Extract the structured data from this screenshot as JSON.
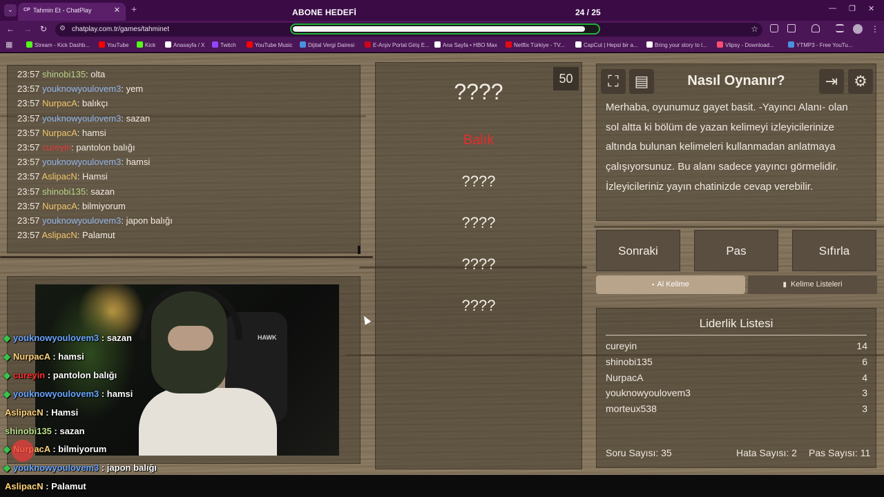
{
  "browser": {
    "tab_title": "Tahmin Et - ChatPlay",
    "tab_favicon": "CP",
    "url": "chatplay.com.tr/games/tahminet",
    "bookmarks": [
      {
        "label": "Stream - Kick Dashb...",
        "color": "#53fc18"
      },
      {
        "label": "YouTube",
        "color": "#ff0000"
      },
      {
        "label": "Kick",
        "color": "#53fc18"
      },
      {
        "label": "Anasayfa / X",
        "color": "#ffffff"
      },
      {
        "label": "Twitch",
        "color": "#9146ff"
      },
      {
        "label": "YouTube Music",
        "color": "#ff0000"
      },
      {
        "label": "Dijital Vergi Dairesi",
        "color": "#4a90e2"
      },
      {
        "label": "E-Arşiv Portal Giriş E...",
        "color": "#d0021b"
      },
      {
        "label": "Ana Sayfa • HBO Max",
        "color": "#ffffff"
      },
      {
        "label": "Netflix Türkiye - TV...",
        "color": "#e50914"
      },
      {
        "label": "CapCut | Hepsi bir a...",
        "color": "#ffffff"
      },
      {
        "label": "Bring your story to l...",
        "color": "#ffffff"
      },
      {
        "label": "Vlipsy - Download...",
        "color": "#ff4d6d"
      },
      {
        "label": "YTMP3 - Free YouTu...",
        "color": "#4a90e2"
      }
    ]
  },
  "goal": {
    "label": "ABONE HEDEFİ",
    "count": "24 / 25",
    "progress": 0.96
  },
  "chat_log": [
    {
      "time": "23:57",
      "user": "shinobi135",
      "color": "#b9d38a",
      "msg": "olta"
    },
    {
      "time": "23:57",
      "user": "youknowyoulovem3",
      "color": "#8fb5ec",
      "msg": "yem"
    },
    {
      "time": "23:57",
      "user": "NurpacA",
      "color": "#f0c66c",
      "msg": "balıkçı"
    },
    {
      "time": "23:57",
      "user": "youknowyoulovem3",
      "color": "#8fb5ec",
      "msg": "sazan"
    },
    {
      "time": "23:57",
      "user": "NurpacA",
      "color": "#f0c66c",
      "msg": "hamsi"
    },
    {
      "time": "23:57",
      "user": "cureyin",
      "color": "#e33b3b",
      "msg": "pantolon balığı"
    },
    {
      "time": "23:57",
      "user": "youknowyoulovem3",
      "color": "#8fb5ec",
      "msg": "hamsi"
    },
    {
      "time": "23:57",
      "user": "AslipacN",
      "color": "#f0c66c",
      "msg": "Hamsi"
    },
    {
      "time": "23:57",
      "user": "shinobi135",
      "color": "#b9d38a",
      "msg": "sazan"
    },
    {
      "time": "23:57",
      "user": "NurpacA",
      "color": "#f0c66c",
      "msg": "bilmiyorum"
    },
    {
      "time": "23:57",
      "user": "youknowyoulovem3",
      "color": "#8fb5ec",
      "msg": "japon balığı"
    },
    {
      "time": "23:57",
      "user": "AslipacN",
      "color": "#f0c66c",
      "msg": "Palamut"
    }
  ],
  "stream_overlay": [
    {
      "user": "youknowyoulovem3",
      "color": "#6aa6ff",
      "msg": "sazan",
      "gem": true
    },
    {
      "user": "NurpacA",
      "color": "#ffd27a",
      "msg": "hamsi",
      "gem": true
    },
    {
      "user": "cureyin",
      "color": "#ff2e2e",
      "msg": "pantolon balığı",
      "gem": true
    },
    {
      "user": "youknowyoulovem3",
      "color": "#6aa6ff",
      "msg": "hamsi",
      "gem": true
    },
    {
      "user": "AslipacN",
      "color": "#ffd27a",
      "msg": "Hamsi",
      "gem": false
    },
    {
      "user": "shinobi135",
      "color": "#b9e08a",
      "msg": "sazan",
      "gem": false
    },
    {
      "user": "NurpacA",
      "color": "#ffd27a",
      "msg": "bilmiyorum",
      "gem": true
    },
    {
      "user": "youknowyoulovem3",
      "color": "#6aa6ff",
      "msg": "japon balığı",
      "gem": true
    },
    {
      "user": "AslipacN",
      "color": "#ffd27a",
      "msg": "Palamut",
      "gem": false
    }
  ],
  "webcam": {
    "chair_text": "HAWK"
  },
  "game": {
    "timer": "50",
    "words": [
      "????",
      "Balık",
      "????",
      "????",
      "????",
      "????"
    ]
  },
  "howto": {
    "title": "Nasıl Oynanır?",
    "text": "Merhaba, oyunumuz gayet basit. -Yayıncı Alanı- olan sol altta ki bölüm de yazan kelimeyi izleyicilerinize altında bulunan kelimeleri kullanmadan anlatmaya çalışıyorsunuz. Bu alanı sadece yayıncı görmelidir. İzleyicileriniz yayın chatinizde cevap verebilir."
  },
  "controls": {
    "next": "Sonraki",
    "pass": "Pas",
    "reset": "Sıfırla",
    "get_word": "Al Kelime",
    "word_lists": "Kelime Listeleri"
  },
  "leaderboard": {
    "title": "Liderlik Listesi",
    "rows": [
      {
        "name": "cureyin",
        "score": "14"
      },
      {
        "name": "shinobi135",
        "score": "6"
      },
      {
        "name": "NurpacA",
        "score": "4"
      },
      {
        "name": "youknowyoulovem3",
        "score": "3"
      },
      {
        "name": "morteux538",
        "score": "3"
      }
    ],
    "questions": "Soru Sayısı: 35",
    "errors": "Hata Sayısı: 2",
    "passes": "Pas Sayısı: 11"
  }
}
